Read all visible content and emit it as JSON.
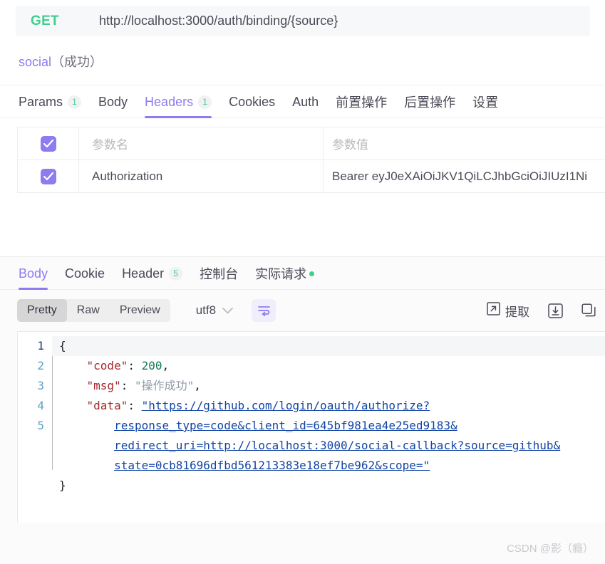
{
  "request": {
    "method": "GET",
    "url": "http://localhost:3000/auth/binding/{source}",
    "name": "social",
    "status": "（成功）",
    "tabs": [
      {
        "label": "Params",
        "badge": "1",
        "active": false
      },
      {
        "label": "Body",
        "badge": "",
        "active": false
      },
      {
        "label": "Headers",
        "badge": "1",
        "active": true
      },
      {
        "label": "Cookies",
        "badge": "",
        "active": false
      },
      {
        "label": "Auth",
        "badge": "",
        "active": false
      },
      {
        "label": "前置操作",
        "badge": "",
        "active": false
      },
      {
        "label": "后置操作",
        "badge": "",
        "active": false
      },
      {
        "label": "设置",
        "badge": "",
        "active": false
      }
    ]
  },
  "params_table": {
    "header": {
      "key_placeholder": "参数名",
      "value_placeholder": "参数值",
      "checked": true
    },
    "rows": [
      {
        "checked": true,
        "key": "Authorization",
        "value": "Bearer eyJ0eXAiOiJKV1QiLCJhbGciOiJIUzI1Ni"
      }
    ]
  },
  "response": {
    "tabs": [
      {
        "label": "Body",
        "badge": "",
        "dot": false,
        "active": true
      },
      {
        "label": "Cookie",
        "badge": "",
        "dot": false,
        "active": false
      },
      {
        "label": "Header",
        "badge": "5",
        "dot": false,
        "active": false
      },
      {
        "label": "控制台",
        "badge": "",
        "dot": false,
        "active": false
      },
      {
        "label": "实际请求",
        "badge": "",
        "dot": true,
        "active": false
      }
    ],
    "toolbar": {
      "views": [
        {
          "label": "Pretty",
          "active": true
        },
        {
          "label": "Raw",
          "active": false
        },
        {
          "label": "Preview",
          "active": false
        }
      ],
      "encoding": "utf8",
      "wrap_icon": "wrap-lines-icon",
      "extract_label": "提取",
      "extract_icon": "extract-icon",
      "download_icon": "download-icon",
      "copy_icon": "copy-icon"
    },
    "code": {
      "line_numbers": [
        "1",
        "2",
        "3",
        "4",
        "5"
      ],
      "lines": [
        {
          "indent": 0,
          "tokens": [
            {
              "t": "{",
              "c": "punct"
            }
          ]
        },
        {
          "indent": 1,
          "tokens": [
            {
              "t": "\"code\"",
              "c": "key"
            },
            {
              "t": ": ",
              "c": "punct"
            },
            {
              "t": "200",
              "c": "num"
            },
            {
              "t": ",",
              "c": "punct"
            }
          ]
        },
        {
          "indent": 1,
          "tokens": [
            {
              "t": "\"msg\"",
              "c": "key"
            },
            {
              "t": ": ",
              "c": "punct"
            },
            {
              "t": "\"操作成功\"",
              "c": "str"
            },
            {
              "t": ",",
              "c": "punct"
            }
          ]
        },
        {
          "indent": 1,
          "tokens": [
            {
              "t": "\"data\"",
              "c": "key"
            },
            {
              "t": ": ",
              "c": "punct"
            },
            {
              "t": "\"",
              "c": "link"
            },
            {
              "t": "https://github.com/login/oauth/authorize?",
              "c": "link"
            }
          ]
        },
        {
          "indent": 0,
          "tokens": [
            {
              "t": "}",
              "c": "punct"
            }
          ]
        }
      ],
      "data_value_wrapped": [
        "\"https://github.com/login/oauth/authorize?",
        "response_type=code&client_id=645bf981ea4e25ed9183&",
        "redirect_uri=http://localhost:3000/social-callback?source=github&",
        "state=0cb81696dfbd561213383e18ef7be962&scope=\""
      ]
    }
  },
  "watermark": "CSDN @影（瘾）"
}
